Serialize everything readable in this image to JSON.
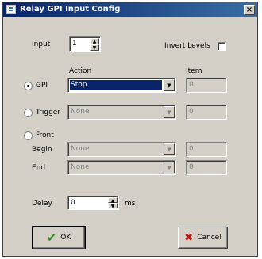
{
  "window": {
    "title": "Relay GPI Input Config",
    "close_glyph": "×"
  },
  "input": {
    "label": "Input",
    "value": "1"
  },
  "invert_levels": {
    "label": "Invert Levels",
    "checked": false
  },
  "headers": {
    "action": "Action",
    "item": "Item"
  },
  "gpi": {
    "label": "GPI",
    "selected": true,
    "action": "Stop",
    "item": "0"
  },
  "trigger": {
    "label": "Trigger",
    "selected": false,
    "action": "None",
    "item": "0"
  },
  "front": {
    "label": "Front",
    "selected": false,
    "begin": {
      "label": "Begin",
      "action": "None",
      "item": "0"
    },
    "end": {
      "label": "End",
      "action": "None",
      "item": "0"
    }
  },
  "delay": {
    "label": "Delay",
    "value": "0",
    "unit": "ms"
  },
  "buttons": {
    "ok": "OK",
    "cancel": "Cancel"
  },
  "icons": {
    "ok": "check-icon",
    "cancel": "x-icon"
  },
  "colors": {
    "titlebar": "#0a246a",
    "selection": "#0a246a",
    "dialog": "#d4d0c8"
  }
}
